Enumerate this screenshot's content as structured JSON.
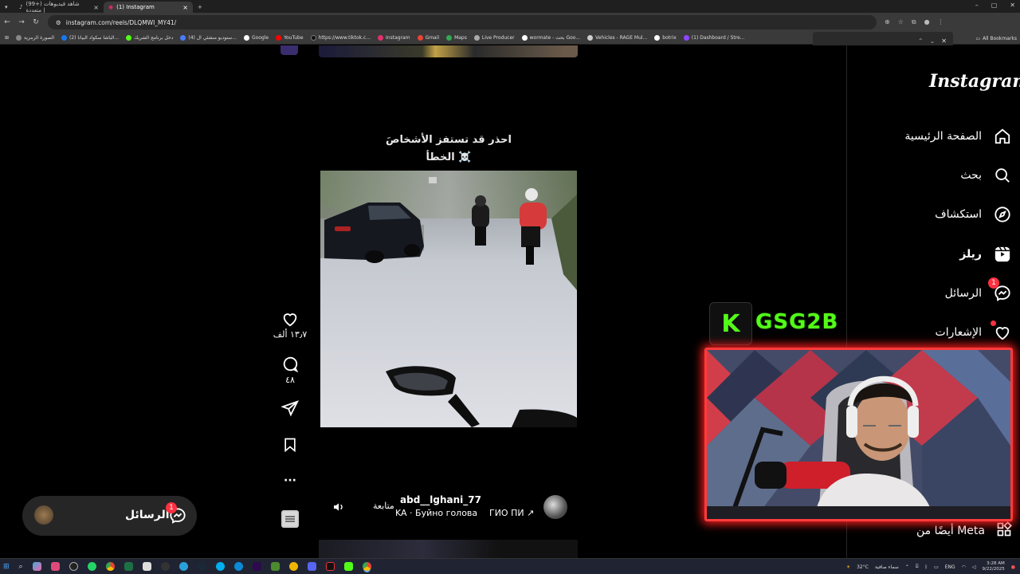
{
  "browser": {
    "tabs": [
      {
        "title": "(99+) شاهد فيديوهات متعددة |",
        "active": false
      },
      {
        "title": "(1) Instagram",
        "active": true
      }
    ],
    "url": "instagram.com/reels/DLQMWI_MY41/",
    "bookmarks": [
      "الصورة الرمزية",
      "(2) الباشا سكواد البيانا...",
      "دخل برنامج الشريك",
      "(4) ستوديو منشئي ال...",
      "Google",
      "YouTube",
      "https://www.tiktok.c...",
      "Instagram",
      "Gmail",
      "Maps",
      "Live Producer",
      "wormate - بحث Goo...",
      "Vehicles - RAGE Mul...",
      "botrix",
      "(1) Dashboard / Stre..."
    ],
    "all_bookmarks": "All Bookmarks"
  },
  "instagram": {
    "logo": "Instagram",
    "nav": [
      {
        "label": "الصفحة الرئيسية",
        "icon": "home-icon"
      },
      {
        "label": "بحث",
        "icon": "search-icon"
      },
      {
        "label": "استكشاف",
        "icon": "explore-icon"
      },
      {
        "label": "ريلز",
        "icon": "reels-icon"
      },
      {
        "label": "الرسائل",
        "icon": "messenger-icon",
        "badge": "1"
      },
      {
        "label": "الإشعارات",
        "icon": "heart-icon"
      }
    ],
    "more_from_meta": "أيضًا من Meta"
  },
  "reel": {
    "caption_line1": "احذر قد تستفز الأشخاصَ",
    "caption_line2": "الخطأ ☠️",
    "likes": "١٣٫٧ ألف",
    "comments": "٤٨",
    "owner": "abd__lghani_77",
    "follow": "متابعة",
    "song": "KA · Буйно голова",
    "audio": "ГИО ПИ ↗"
  },
  "messages_pill": {
    "label": "الرسائل",
    "badge": "1"
  },
  "overlay": {
    "brand": "GSG2B",
    "k": "K"
  },
  "taskbar": {
    "weather": "32°C",
    "weather_desc": "سماء صافية",
    "lang": "ENG",
    "time": "3:28 AM",
    "date": "9/22/2025"
  }
}
